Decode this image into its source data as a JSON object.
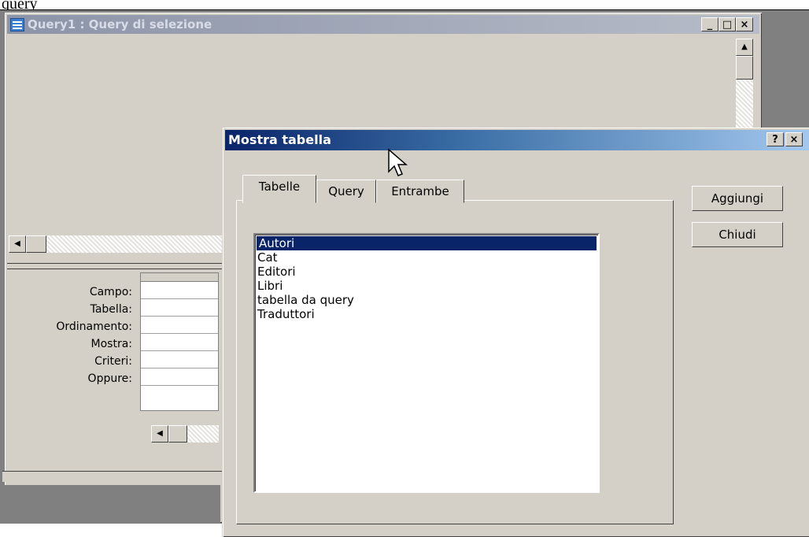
{
  "caption": "query",
  "query_window": {
    "title": "Query1 : Query di selezione",
    "minimize_label": "_",
    "maximize_label": "□",
    "close_label": "×"
  },
  "grid": {
    "row_labels": [
      "Campo:",
      "Tabella:",
      "Ordinamento:",
      "Mostra:",
      "Criteri:",
      "Oppure:"
    ]
  },
  "dialog": {
    "title": "Mostra tabella",
    "help_label": "?",
    "close_label": "×",
    "tabs": [
      {
        "label": "Tabelle"
      },
      {
        "label": "Query"
      },
      {
        "label": "Entrambe"
      }
    ],
    "tables": [
      "Autori",
      "Cat",
      "Editori",
      "Libri",
      "tabella da query",
      "Traduttori"
    ],
    "selected": "Autori",
    "add_label": "Aggiungi",
    "close_button_label": "Chiudi"
  },
  "colors": {
    "dialog_title_start": "#0a246a",
    "dialog_title_end": "#a6caf0",
    "selection": "#0a246a",
    "face": "#d4d0c8"
  }
}
